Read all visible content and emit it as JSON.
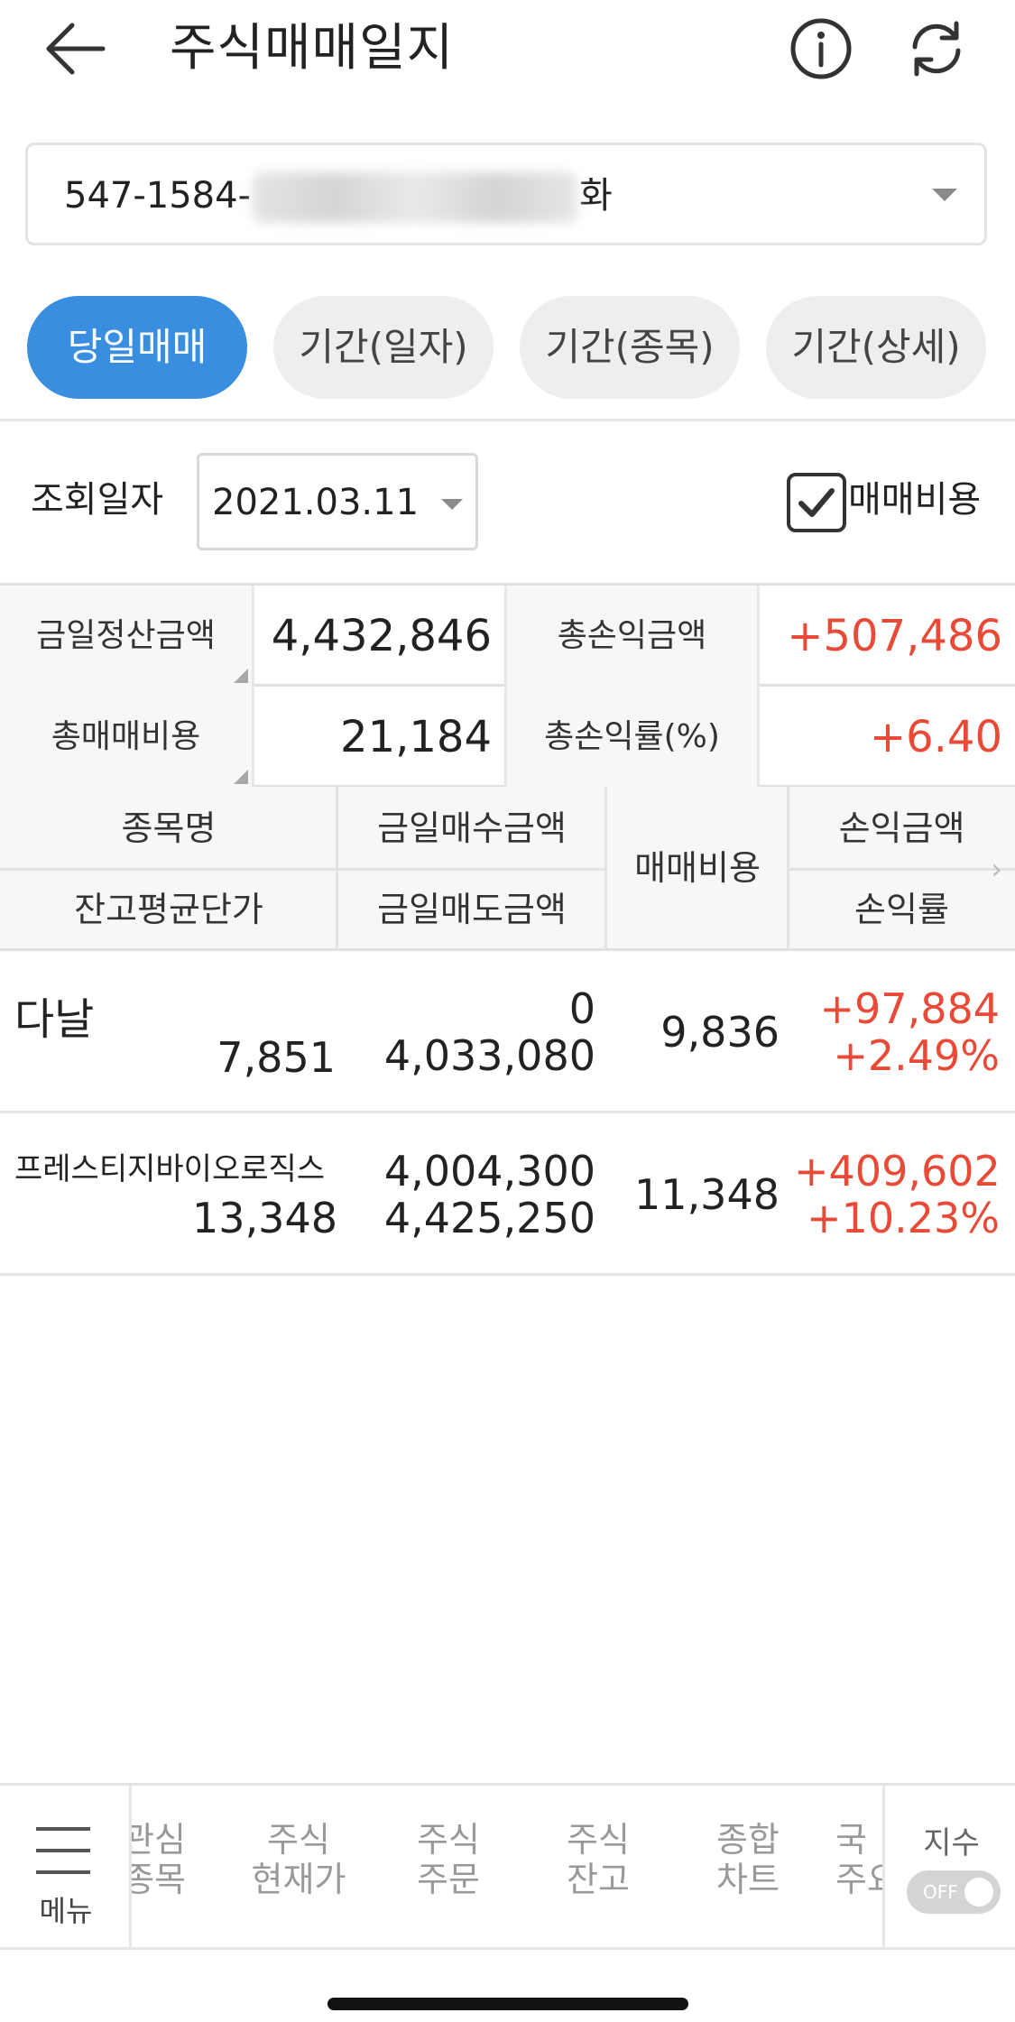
{
  "header": {
    "title": "주식매매일지",
    "back_icon": "arrow-left-icon",
    "info_icon": "info-icon",
    "refresh_icon": "refresh-icon"
  },
  "account": {
    "prefix": "547-1584-",
    "suffix": "화"
  },
  "tabs": [
    {
      "label": "당일매매",
      "active": true
    },
    {
      "label": "기간(일자)",
      "active": false
    },
    {
      "label": "기간(종목)",
      "active": false
    },
    {
      "label": "기간(상세)",
      "active": false
    }
  ],
  "query": {
    "label": "조회일자",
    "date": "2021.03.11",
    "checkbox_label": "매매비용",
    "checkbox_checked": true
  },
  "summary": {
    "today_settle_label": "금일정산금액",
    "today_settle_value": "4,432,846",
    "total_pl_label": "총손익금액",
    "total_pl_value": "+507,486",
    "total_cost_label": "총매매비용",
    "total_cost_value": "21,184",
    "total_pl_rate_label": "총손익률(%)",
    "total_pl_rate_value": "+6.40"
  },
  "columns": {
    "name": "종목명",
    "avg_price": "잔고평균단가",
    "buy_amount": "금일매수금액",
    "sell_amount": "금일매도금액",
    "cost": "매매비용",
    "pl_amount": "손익금액",
    "pl_rate": "손익률"
  },
  "rows": [
    {
      "name": "다날",
      "avg_price": "7,851",
      "buy": "0",
      "sell": "4,033,080",
      "cost": "9,836",
      "pl": "+97,884",
      "rate": "+2.49%"
    },
    {
      "name": "프레스티지바이오로직스",
      "avg_price": "13,348",
      "buy": "4,004,300",
      "sell": "4,425,250",
      "cost": "11,348",
      "pl": "+409,602",
      "rate": "+10.23%"
    }
  ],
  "bottom_nav": {
    "menu_label": "메뉴",
    "items": [
      {
        "l1": "관심",
        "l2": "종목"
      },
      {
        "l1": "주식",
        "l2": "현재가"
      },
      {
        "l1": "주식",
        "l2": "주문"
      },
      {
        "l1": "주식",
        "l2": "잔고"
      },
      {
        "l1": "종합",
        "l2": "차트"
      },
      {
        "l1": "국",
        "l2": "주요"
      }
    ],
    "index_label": "지수",
    "toggle_state": "OFF"
  },
  "colors": {
    "accent_blue": "#3a8ee0",
    "profit_red": "#e84a37",
    "sell_blue": "#1c7fd0"
  }
}
